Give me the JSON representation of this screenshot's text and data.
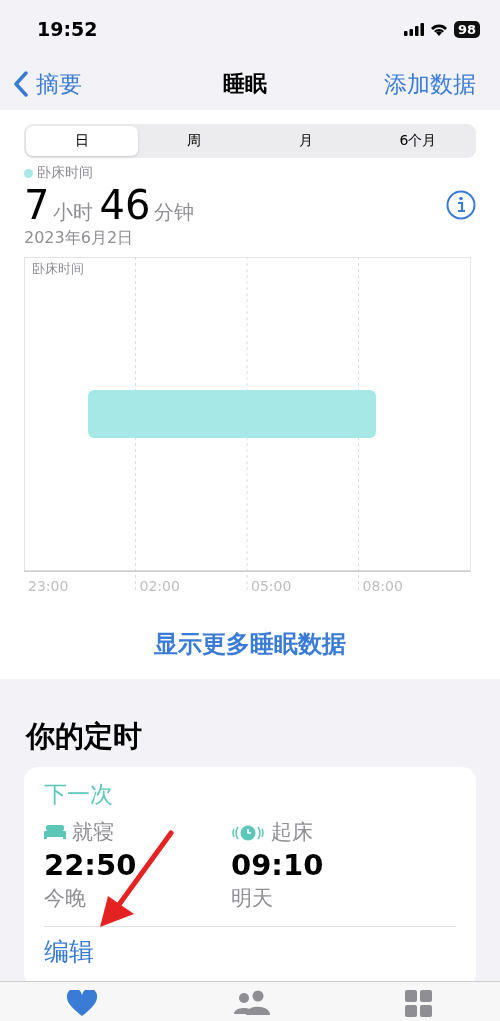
{
  "status_bar": {
    "time": "19:52",
    "battery": "98"
  },
  "nav": {
    "back": "摘要",
    "title": "睡眠",
    "action": "添加数据"
  },
  "segments": [
    {
      "label": "日",
      "selected": true
    },
    {
      "label": "周",
      "selected": false
    },
    {
      "label": "月",
      "selected": false
    },
    {
      "label": "6个月",
      "selected": false
    }
  ],
  "summary": {
    "legend": "卧床时间",
    "hours": "7",
    "hours_unit": "小时",
    "minutes": "46",
    "minutes_unit": "分钟",
    "date": "2023年6月2日"
  },
  "chart": {
    "title": "卧床时间",
    "x_labels": [
      "23:00",
      "02:00",
      "05:00",
      "08:00"
    ]
  },
  "more_link": "显示更多睡眠数据",
  "schedule": {
    "heading": "你的定时",
    "next_label": "下一次",
    "items": [
      {
        "kind": "bed",
        "label": "就寝",
        "time": "22:50",
        "day": "今晚"
      },
      {
        "kind": "wake",
        "label": "起床",
        "time": "09:10",
        "day": "明天"
      }
    ],
    "edit": "编辑"
  },
  "tab_bar": [
    {
      "kind": "heart",
      "selected": true
    },
    {
      "kind": "people",
      "selected": false
    },
    {
      "kind": "grid",
      "selected": false
    }
  ]
}
